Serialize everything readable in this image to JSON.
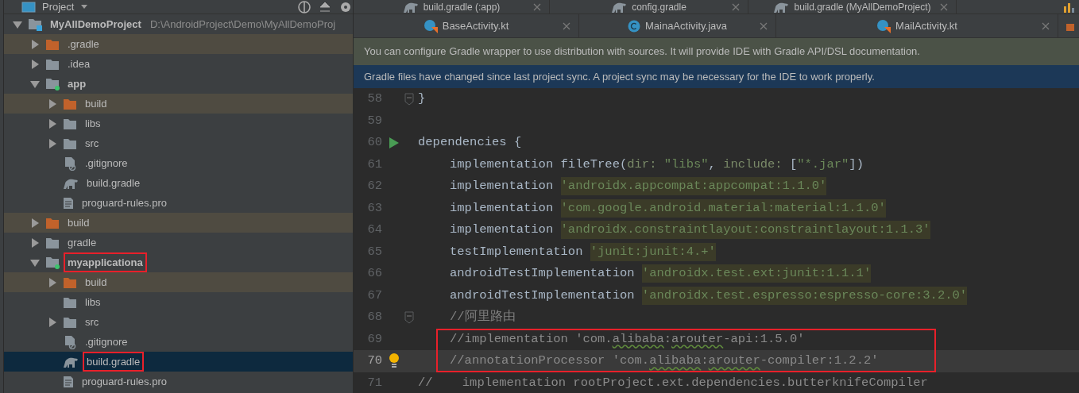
{
  "project_panel": {
    "title": "Project",
    "tree": [
      {
        "label": "MyAllDemoProject",
        "path": "D:\\AndroidProject\\Demo\\MyAllDemoProj",
        "kind": "project",
        "expanded": true,
        "selected": false,
        "annotated": false,
        "children": [
          {
            "label": ".gradle",
            "kind": "excluded",
            "expanded": false,
            "selected": false,
            "annotated": false
          },
          {
            "label": ".idea",
            "kind": "folder",
            "expanded": false,
            "selected": false,
            "annotated": false
          },
          {
            "label": "app",
            "kind": "module",
            "expanded": true,
            "selected": false,
            "annotated": false,
            "children": [
              {
                "label": "build",
                "kind": "excluded",
                "expanded": false,
                "selected": false,
                "annotated": false
              },
              {
                "label": "libs",
                "kind": "folder",
                "expanded": false,
                "selected": false,
                "annotated": false
              },
              {
                "label": "src",
                "kind": "folder",
                "expanded": false,
                "selected": false,
                "annotated": false
              },
              {
                "label": ".gitignore",
                "kind": "ignore-file",
                "selected": false,
                "annotated": false
              },
              {
                "label": "build.gradle",
                "kind": "gradle-file",
                "selected": false,
                "annotated": false
              },
              {
                "label": "proguard-rules.pro",
                "kind": "text-file",
                "selected": false,
                "annotated": false
              }
            ]
          },
          {
            "label": "build",
            "kind": "excluded",
            "expanded": false,
            "selected": false,
            "annotated": false
          },
          {
            "label": "gradle",
            "kind": "folder",
            "expanded": false,
            "selected": false,
            "annotated": false
          },
          {
            "label": "myapplicationa",
            "kind": "module",
            "expanded": true,
            "selected": false,
            "annotated": true,
            "children": [
              {
                "label": "build",
                "kind": "excluded",
                "expanded": false,
                "selected": false,
                "annotated": false
              },
              {
                "label": "libs",
                "kind": "folder",
                "selected": false,
                "annotated": false
              },
              {
                "label": "src",
                "kind": "folder",
                "expanded": false,
                "selected": false,
                "annotated": false
              },
              {
                "label": ".gitignore",
                "kind": "ignore-file",
                "selected": false,
                "annotated": false
              },
              {
                "label": "build.gradle",
                "kind": "gradle-file",
                "selected": true,
                "annotated": true
              },
              {
                "label": "proguard-rules.pro",
                "kind": "text-file",
                "selected": false,
                "annotated": false
              }
            ]
          }
        ]
      }
    ]
  },
  "tab_rows": [
    [
      {
        "label": "build.gradle (:app)",
        "kind": "gradle",
        "selected": false
      },
      {
        "label": "config.gradle",
        "kind": "gradle",
        "selected": false
      },
      {
        "label": "build.gradle (MyAllDemoProject)",
        "kind": "gradle",
        "selected": false
      }
    ],
    [
      {
        "label": "BaseActivity.kt",
        "kind": "kotlin",
        "selected": false
      },
      {
        "label": "MainaActivity.java",
        "kind": "java",
        "selected": false
      },
      {
        "label": "MailActivity.kt",
        "kind": "kotlin",
        "selected": false
      }
    ]
  ],
  "notifications": [
    {
      "text": "You can configure Gradle wrapper to use distribution with sources. It will provide IDE with Gradle API/DSL documentation.",
      "kind": "info"
    },
    {
      "text": "Gradle files have changed since last project sync. A project sync may be necessary for the IDE to work properly.",
      "kind": "warning"
    }
  ],
  "editor": {
    "lines": [
      {
        "number": "58",
        "indent": false,
        "current": false,
        "kind": "fold",
        "tokens": [
          {
            "text": "}",
            "kind": "plain"
          }
        ]
      },
      {
        "number": "59",
        "current": false,
        "kind": "plain"
      },
      {
        "number": "60",
        "indent": false,
        "current": false,
        "kind": "run",
        "tokens": [
          {
            "text": "dependencies {",
            "kind": "plain"
          }
        ]
      },
      {
        "number": "61",
        "indent": true,
        "current": false,
        "kind": "plain",
        "tokens": [
          {
            "text": "implementation fileTree(",
            "kind": "plain"
          },
          {
            "text": "dir: ",
            "kind": "param"
          },
          {
            "text": "\"libs\"",
            "kind": "string"
          },
          {
            "text": ", ",
            "kind": "plain"
          },
          {
            "text": "include: ",
            "kind": "param"
          },
          {
            "text": "[",
            "kind": "plain"
          },
          {
            "text": "\"*.jar\"",
            "kind": "string"
          },
          {
            "text": "])",
            "kind": "plain"
          }
        ]
      },
      {
        "number": "62",
        "indent": true,
        "current": false,
        "kind": "plain",
        "tokens": [
          {
            "text": "implementation ",
            "kind": "plain"
          },
          {
            "text": "'androidx.appcompat:appcompat:1.1.0'",
            "kind": "marked-string"
          }
        ]
      },
      {
        "number": "63",
        "indent": true,
        "current": false,
        "kind": "plain",
        "tokens": [
          {
            "text": "implementation ",
            "kind": "plain"
          },
          {
            "text": "'com.google.android.material:material:1.1.0'",
            "kind": "marked-string"
          }
        ]
      },
      {
        "number": "64",
        "indent": true,
        "current": false,
        "kind": "plain",
        "tokens": [
          {
            "text": "implementation ",
            "kind": "plain"
          },
          {
            "text": "'androidx.constraintlayout:constraintlayout:1.1.3'",
            "kind": "marked-string"
          }
        ]
      },
      {
        "number": "65",
        "indent": true,
        "current": false,
        "kind": "plain",
        "tokens": [
          {
            "text": "testImplementation ",
            "kind": "plain"
          },
          {
            "text": "'junit:junit:4.+'",
            "kind": "marked-string"
          }
        ]
      },
      {
        "number": "66",
        "indent": true,
        "current": false,
        "kind": "plain",
        "tokens": [
          {
            "text": "androidTestImplementation ",
            "kind": "plain"
          },
          {
            "text": "'androidx.test.ext:junit:1.1.1'",
            "kind": "marked-string"
          }
        ]
      },
      {
        "number": "67",
        "indent": true,
        "current": false,
        "kind": "plain",
        "tokens": [
          {
            "text": "androidTestImplementation ",
            "kind": "plain"
          },
          {
            "text": "'androidx.test.espresso:espresso-core:3.2.0'",
            "kind": "marked-string"
          }
        ]
      },
      {
        "number": "68",
        "indent": true,
        "current": false,
        "kind": "fold",
        "tokens": [
          {
            "text": "//阿里路由",
            "kind": "comment"
          }
        ]
      },
      {
        "kind": "annotated-group",
        "lines": [
          {
            "number": "69",
            "indent": true,
            "current": false,
            "kind": "plain",
            "tokens": [
              {
                "text": "//implementation 'com.",
                "kind": "comment-dim"
              },
              {
                "text": "alibaba",
                "kind": "typo"
              },
              {
                "text": ":",
                "kind": "comment-dim"
              },
              {
                "text": "arouter",
                "kind": "typo"
              },
              {
                "text": "-api:1.5.0'",
                "kind": "comment-dim"
              }
            ]
          },
          {
            "number": "70",
            "indent": true,
            "current": true,
            "kind": "bulb",
            "tokens": [
              {
                "text": "//annotationProcessor 'com.",
                "kind": "comment-dim"
              },
              {
                "text": "alibaba",
                "kind": "typo"
              },
              {
                "text": ":",
                "kind": "comment-dim"
              },
              {
                "text": "arouter",
                "kind": "typo"
              },
              {
                "text": "-compiler:1.2.2'",
                "kind": "comment-dim"
              }
            ]
          }
        ]
      },
      {
        "number": "71",
        "indent": false,
        "current": false,
        "kind": "plain",
        "tokens": [
          {
            "text": "//    implementation rootProject.ext.dependencies.butterknifeCompiler",
            "kind": "comment-dim"
          }
        ]
      }
    ]
  }
}
